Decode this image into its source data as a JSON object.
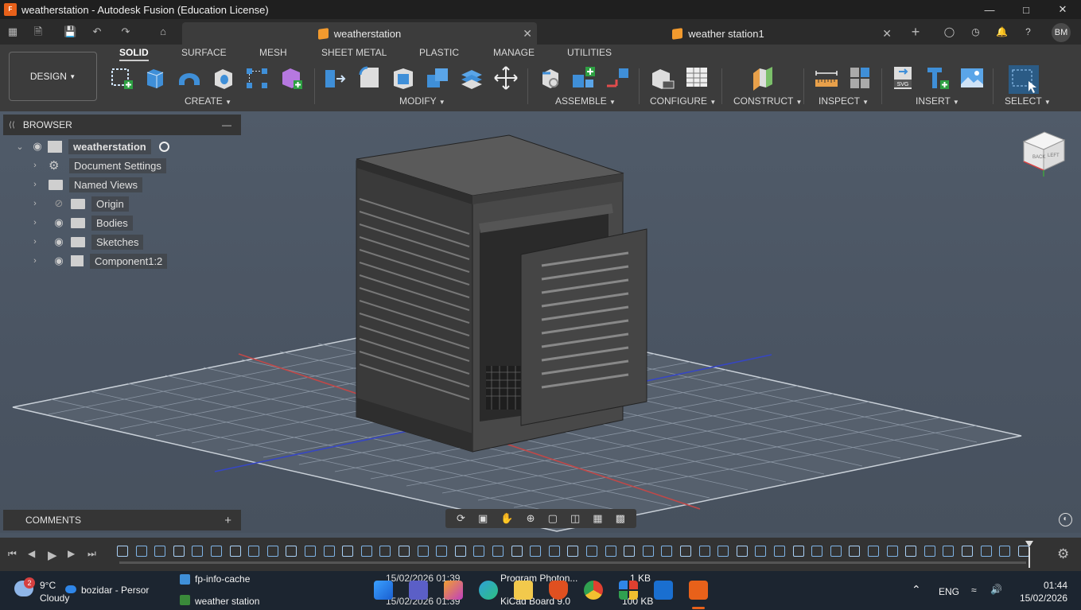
{
  "window": {
    "title": "weatherstation - Autodesk Fusion (Education License)",
    "app_icon": "F"
  },
  "tabs": [
    {
      "label": "weatherstation"
    },
    {
      "label": "weather station1"
    }
  ],
  "user": {
    "initials": "BM"
  },
  "toolbar": {
    "design_label": "DESIGN",
    "tabs": [
      "SOLID",
      "SURFACE",
      "MESH",
      "SHEET METAL",
      "PLASTIC",
      "MANAGE",
      "UTILITIES"
    ],
    "groups": [
      "CREATE",
      "MODIFY",
      "ASSEMBLE",
      "CONFIGURE",
      "CONSTRUCT",
      "INSPECT",
      "INSERT",
      "SELECT"
    ]
  },
  "browser": {
    "title": "BROWSER",
    "root": "weatherstation",
    "items": [
      "Document Settings",
      "Named Views",
      "Origin",
      "Bodies",
      "Sketches",
      "Component1:2"
    ]
  },
  "comments": {
    "title": "COMMENTS"
  },
  "viewcube": {
    "front": "BACK",
    "side": "LEFT"
  },
  "taskbar": {
    "weather_temp": "9°C",
    "weather_desc": "Cloudy",
    "weather_badge": "2",
    "profile": "bozidar - Persor",
    "file1": "fp-info-cache",
    "file2": "weather station",
    "date1": "15/02/2026 01:39",
    "date2": "15/02/2026 01:39",
    "program1": "Program Photon...",
    "program2": "KiCad Board 9.0",
    "size1": "1 KB",
    "size2": "100 KB",
    "lang": "ENG",
    "time": "01:44",
    "date": "15/02/2026"
  },
  "colors": {
    "accent": "#e8611a",
    "grid_red": "#c04040",
    "grid_blue": "#4050c0",
    "model": "#4f4f4f"
  }
}
